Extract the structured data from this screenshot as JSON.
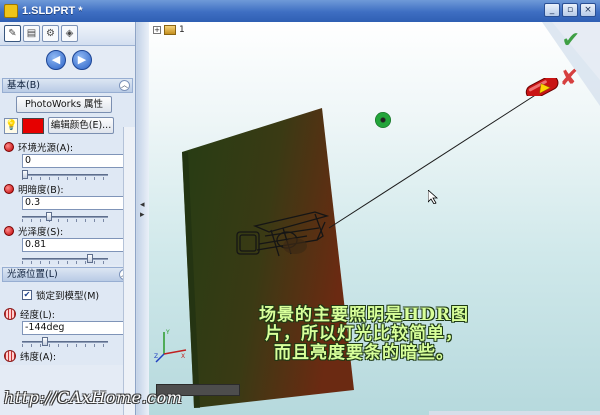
{
  "window": {
    "title": "1.SLDPRT *",
    "buttons": [
      "_",
      "▫",
      "×"
    ]
  },
  "panel": {
    "tabs": [
      "property-tab",
      "config-tab",
      "appearance-tab",
      "render-tab"
    ],
    "nav": {
      "prev": "◀",
      "next": "▶"
    },
    "basic": {
      "header": "基本(B)",
      "photoworks_button": "PhotoWorks 属性",
      "edit_color_button": "编辑颜色(E)...",
      "color": "#e60000",
      "ambient_label": "环境光源(A):",
      "ambient_value": "0",
      "ambient_level": 0.0,
      "brightness_label": "明暗度(B):",
      "brightness_value": "0.3",
      "brightness_level": 0.3,
      "specular_label": "光泽度(S):",
      "specular_value": "0.81",
      "specular_level": 0.81
    },
    "position": {
      "header": "光源位置(L)",
      "lock_label": "锁定到模型(M)",
      "lock_checked": true,
      "longitude_label": "经度(L):",
      "longitude_value": "-144deg",
      "latitude_label": "纬度(A):"
    }
  },
  "viewport": {
    "tree_label": "1",
    "caption_lines": [
      "场景的主要照明是HDR图",
      "片，所以灯光比较简单，",
      "而且亮度要条的暗些。"
    ],
    "watermark": "http://CAxHome.com"
  },
  "colors": {
    "accent_green": "#3e9f44",
    "cancel_red": "#d64040",
    "caption": "#d8ff9a"
  }
}
